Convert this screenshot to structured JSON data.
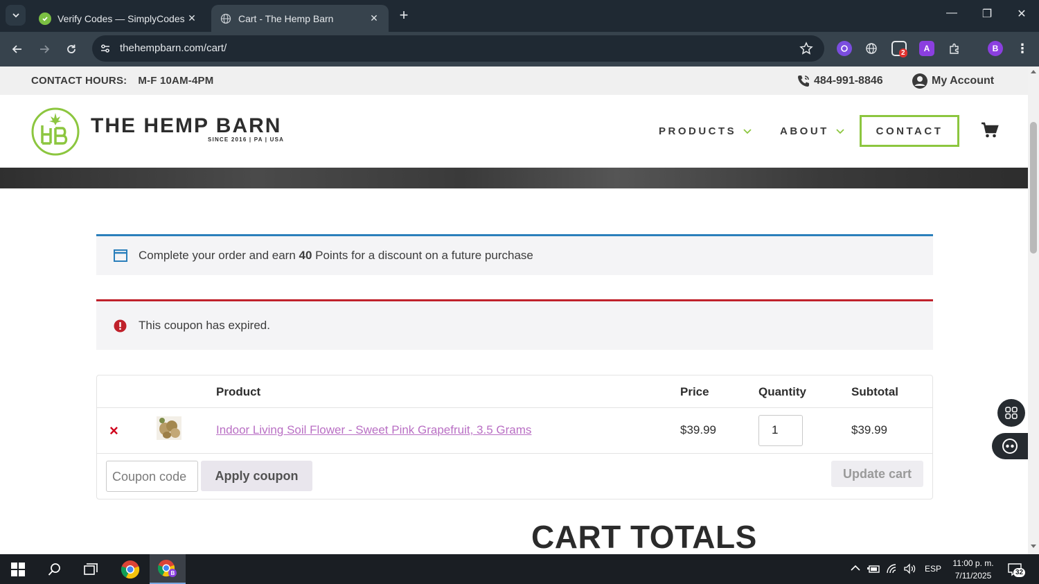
{
  "browser": {
    "tabs": [
      {
        "title": "Verify Codes — SimplyCodes",
        "active": false
      },
      {
        "title": "Cart - The Hemp Barn",
        "active": true
      }
    ],
    "url": "thehempbarn.com/cart/",
    "extension_badge": "2",
    "profile_initial": "B",
    "ext_a_label": "A"
  },
  "topbar": {
    "hours_label": "CONTACT HOURS:",
    "hours_value": "M-F 10AM-4PM",
    "phone": "484-991-8846",
    "account": "My Account"
  },
  "header": {
    "brand": "THE HEMP BARN",
    "brand_sub": "SINCE 2016  |  PA  |  USA",
    "menu": {
      "products": "PRODUCTS",
      "about": "ABOUT",
      "contact": "CONTACT"
    },
    "accent_color": "#8cc63f"
  },
  "notices": {
    "info_prefix": "Complete your order and earn ",
    "info_points": "40",
    "info_suffix": " Points for a discount on a future purchase",
    "error": "This coupon has expired."
  },
  "cart": {
    "headers": {
      "product": "Product",
      "price": "Price",
      "quantity": "Quantity",
      "subtotal": "Subtotal"
    },
    "items": [
      {
        "name": "Indoor Living Soil Flower - Sweet Pink Grapefruit, 3.5 Grams",
        "price": "$39.99",
        "quantity": "1",
        "subtotal": "$39.99"
      }
    ],
    "coupon_placeholder": "Coupon code",
    "apply_label": "Apply coupon",
    "update_label": "Update cart",
    "remove_symbol": "×"
  },
  "totals": {
    "title": "CART TOTALS"
  },
  "taskbar": {
    "language": "ESP",
    "time": "11:00 p. m.",
    "date": "7/11/2025",
    "notifications": "32"
  }
}
